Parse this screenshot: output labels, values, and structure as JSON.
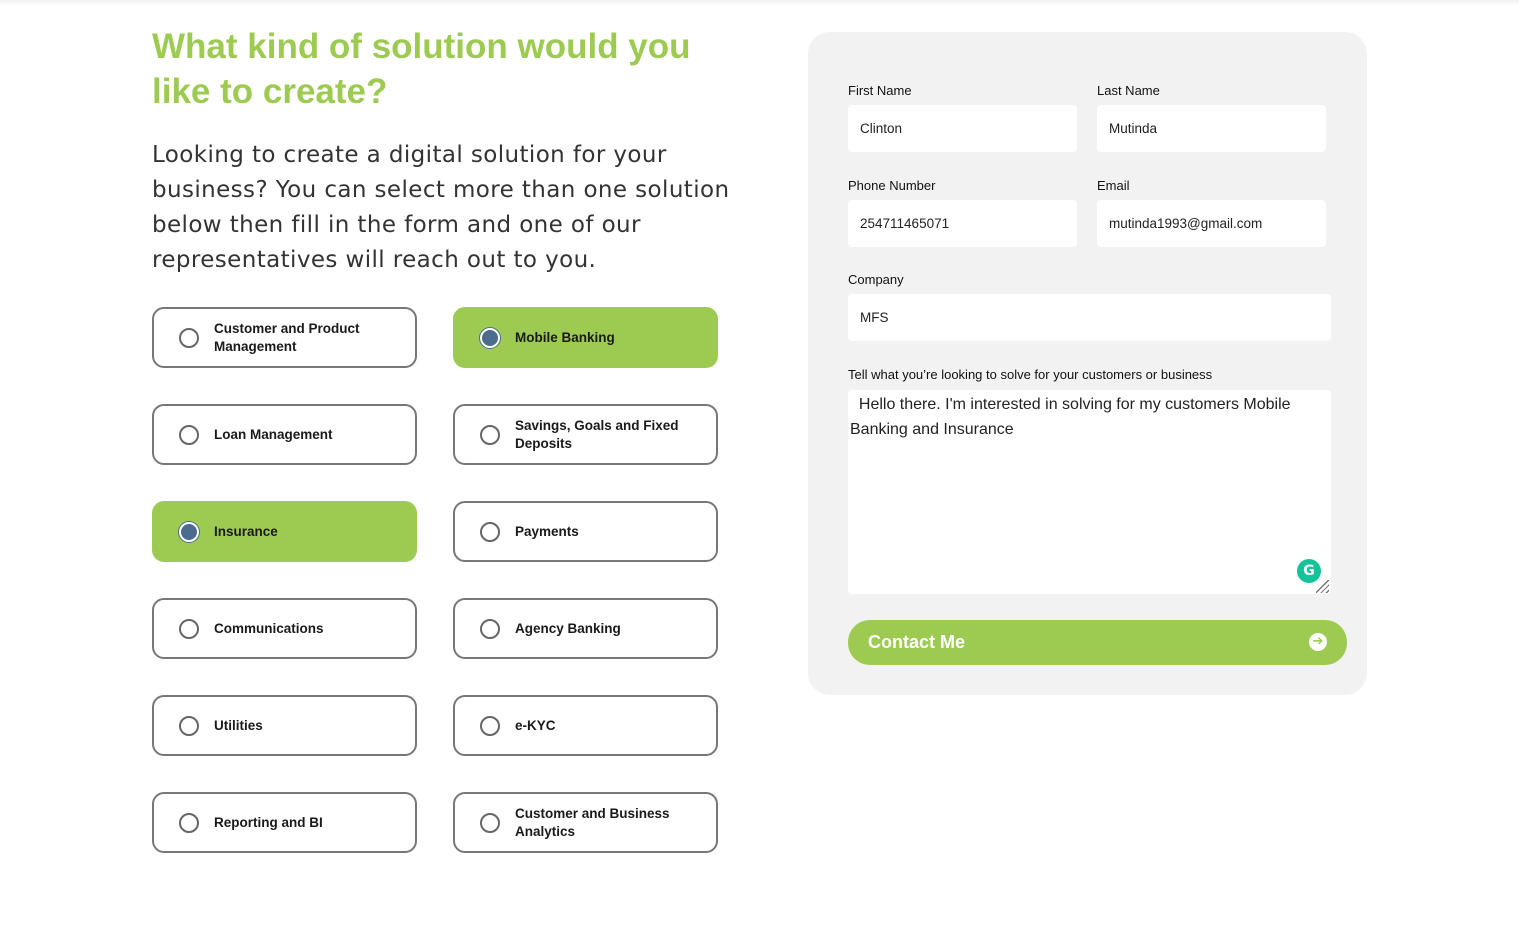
{
  "heading": "What kind of solution would you like to create?",
  "intro": "Looking to create a digital solution for your business? You can select more than one solution below then fill in the form and one of our representatives will reach out to you.",
  "options": [
    {
      "label": "Customer and Product Management",
      "selected": false
    },
    {
      "label": "Mobile Banking",
      "selected": true
    },
    {
      "label": "Loan Management",
      "selected": false
    },
    {
      "label": "Savings, Goals and Fixed Deposits",
      "selected": false
    },
    {
      "label": "Insurance",
      "selected": true
    },
    {
      "label": "Payments",
      "selected": false
    },
    {
      "label": "Communications",
      "selected": false
    },
    {
      "label": "Agency Banking",
      "selected": false
    },
    {
      "label": "Utilities",
      "selected": false
    },
    {
      "label": "e-KYC",
      "selected": false
    },
    {
      "label": "Reporting and BI",
      "selected": false
    },
    {
      "label": "Customer and Business Analytics",
      "selected": false
    }
  ],
  "form": {
    "first_name_label": "First Name",
    "first_name_value": "Clinton",
    "last_name_label": "Last Name",
    "last_name_value": "Mutinda",
    "phone_label": "Phone Number",
    "phone_value": "254711465071",
    "email_label": "Email",
    "email_value": "mutinda1993@gmail.com",
    "company_label": "Company",
    "company_value": "MFS",
    "message_label": "Tell what you’re looking to solve for your customers or business",
    "message_value": "  Hello there. I'm interested in solving for my customers Mobile Banking and Insurance",
    "submit_label": "Contact Me",
    "submit_icon": "arrow-circle-right-icon"
  },
  "colors": {
    "accent": "#9dcb52",
    "radio_selected": "#4b6c8f",
    "card_bg": "#f2f2f2",
    "grammarly": "#15c39a"
  }
}
